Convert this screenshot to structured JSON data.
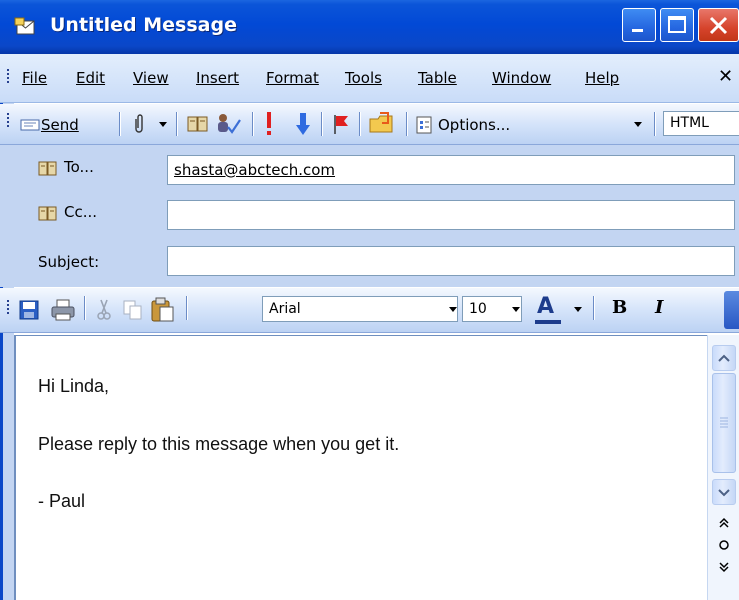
{
  "window": {
    "title": "Untitled Message"
  },
  "menu": {
    "items": [
      "File",
      "Edit",
      "View",
      "Insert",
      "Format",
      "Tools",
      "Table",
      "Window",
      "Help"
    ],
    "close_glyph": "✕"
  },
  "toolbar": {
    "send_label": "Send",
    "options_label": "Options...",
    "format_value": "HTML",
    "icons": [
      "send-icon",
      "paperclip-icon",
      "address-book-icon",
      "check-names-icon",
      "high-importance-icon",
      "low-importance-icon",
      "flag-icon",
      "folder-icon",
      "options-icon"
    ]
  },
  "address": {
    "to_label": "To...",
    "to_value": "shasta@abctech.com",
    "cc_label": "Cc...",
    "cc_value": "",
    "subject_label": "Subject:",
    "subject_value": ""
  },
  "formatting": {
    "font_name": "Arial",
    "font_size": "10",
    "font_color_label": "A",
    "bold_label": "B",
    "italic_label": "I",
    "icons": [
      "save-icon",
      "print-icon",
      "cut-icon",
      "copy-icon",
      "paste-icon"
    ]
  },
  "body": {
    "lines": [
      "Hi Linda,",
      "Please reply to this message when you get it.",
      "- Paul"
    ]
  },
  "colors": {
    "titlebar": "#0249d6",
    "panel": "#c3d5f2",
    "close_button": "#d6442c"
  }
}
